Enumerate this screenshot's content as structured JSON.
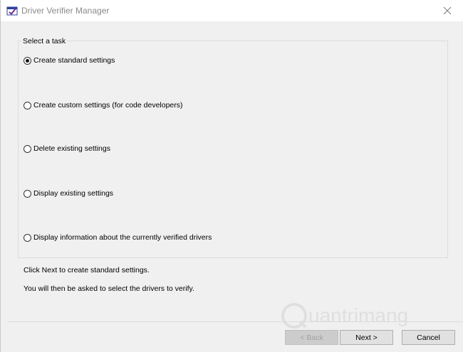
{
  "window": {
    "title": "Driver Verifier Manager",
    "app_icon": "driver-verifier-icon",
    "close_icon": "close-icon"
  },
  "task_group": {
    "legend": "Select a task",
    "options": [
      {
        "label": "Create standard settings",
        "checked": true
      },
      {
        "label": "Create custom settings (for code developers)",
        "checked": false
      },
      {
        "label": "Delete existing settings",
        "checked": false
      },
      {
        "label": "Display existing settings",
        "checked": false
      },
      {
        "label": "Display information about the currently verified drivers",
        "checked": false
      }
    ]
  },
  "info": {
    "line1": "Click Next to create standard settings.",
    "line2": "You will then be asked to select the drivers to verify."
  },
  "buttons": {
    "back": {
      "label": "< Back",
      "enabled": false
    },
    "next": {
      "label": "Next >",
      "enabled": true
    },
    "cancel": {
      "label": "Cancel",
      "enabled": true
    }
  },
  "watermark": {
    "text": "uantrimang"
  },
  "colors": {
    "window_bg": "#f0f0f0",
    "titlebar_bg": "#ffffff",
    "button_bg": "#e1e1e1",
    "button_border": "#adadad",
    "disabled_text": "#a0a0a0",
    "icon_blue": "#2b3fa0"
  }
}
